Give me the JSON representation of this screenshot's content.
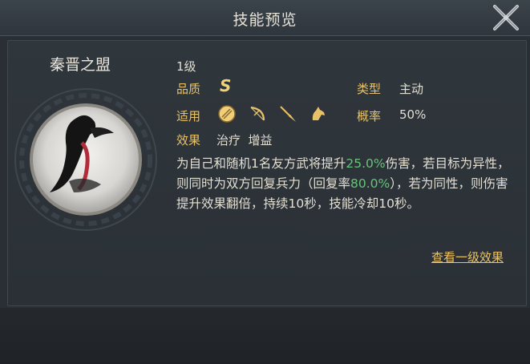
{
  "header": {
    "title": "技能预览"
  },
  "skill": {
    "name": "秦晋之盟",
    "level": "1级",
    "quality_label": "品质",
    "quality_value": "S",
    "type_label": "类型",
    "type_value": "主动",
    "applies_label": "适用",
    "applies_icons": [
      "shield-icon",
      "bow-icon",
      "spear-icon",
      "horse-icon"
    ],
    "rate_label": "概率",
    "rate_value": "50%",
    "effect_label": "效果",
    "effect_value": "治疗  增益",
    "description": {
      "p1": "为自己和随机1名友方武将提升",
      "v1": "25.0%",
      "p2": "伤害，若目标为异性，则同时为双方回复兵力（回复率",
      "v2": "80.0%",
      "p3": "），若为同性，则伤害提升效果翻倍，持续10秒，技能冷却10秒。"
    },
    "link_text": "查看一级效果"
  },
  "colors": {
    "label": "#e9c267",
    "highlight": "#69c37a",
    "text": "#e3dfd3",
    "grade": "#f1d379"
  }
}
